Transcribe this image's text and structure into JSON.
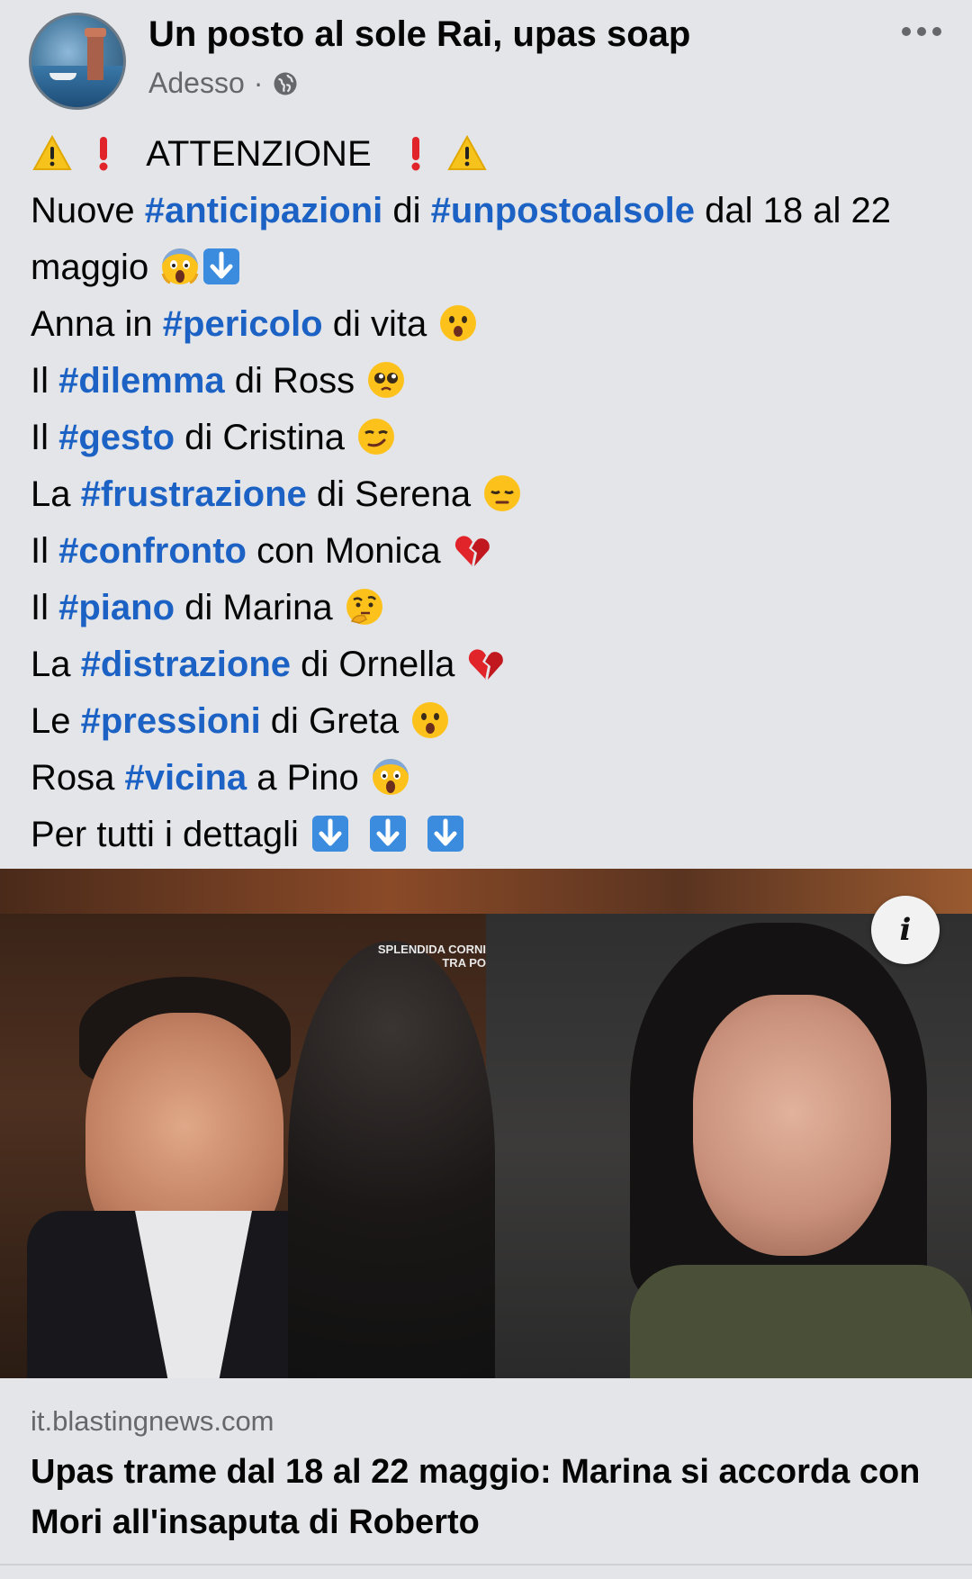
{
  "header": {
    "page_name": "Un posto al sole Rai, upas soap",
    "time": "Adesso",
    "separator": "·"
  },
  "post": {
    "attention": "ATTENZIONE",
    "line1": {
      "pre": "Nuove ",
      "tag1": "#anticipazioni",
      "mid": " di ",
      "tag2": "#unpostoalsole",
      "post": " dal 18 al 22 maggio "
    },
    "lines": [
      {
        "pre": "Anna in ",
        "tag": "#pericolo",
        "post": " di vita ",
        "emoji": "astonished"
      },
      {
        "pre": "Il ",
        "tag": "#dilemma",
        "post": " di Ross ",
        "emoji": "pleading"
      },
      {
        "pre": "Il ",
        "tag": "#gesto",
        "post": " di Cristina ",
        "emoji": "smirk"
      },
      {
        "pre": "La ",
        "tag": "#frustrazione",
        "post": " di Serena ",
        "emoji": "pensive"
      },
      {
        "pre": "Il ",
        "tag": "#confronto",
        "post": " con Monica ",
        "emoji": "broken-heart"
      },
      {
        "pre": "Il ",
        "tag": "#piano",
        "post": " di Marina ",
        "emoji": "thinking"
      },
      {
        "pre": "La ",
        "tag": "#distrazione",
        "post": " di Ornella ",
        "emoji": "broken-heart"
      },
      {
        "pre": "Le ",
        "tag": "#pressioni",
        "post": " di Greta ",
        "emoji": "astonished"
      },
      {
        "pre": "Rosa ",
        "tag": "#vicina",
        "post": " a Pino ",
        "emoji": "scream"
      }
    ],
    "footer": "Per tutti i dettagli "
  },
  "media": {
    "overlay_line1": "SPLENDIDA CORNI",
    "overlay_line2": "TRA PO",
    "info_label": "i"
  },
  "link": {
    "domain": "it.blastingnews.com",
    "title": "Upas trame dal 18 al 22 maggio: Marina si accorda con Mori all'insaputa di Roberto"
  },
  "colors": {
    "background": "#e4e5e9",
    "hashtag": "#1b62c4",
    "secondary_text": "#65676b"
  }
}
